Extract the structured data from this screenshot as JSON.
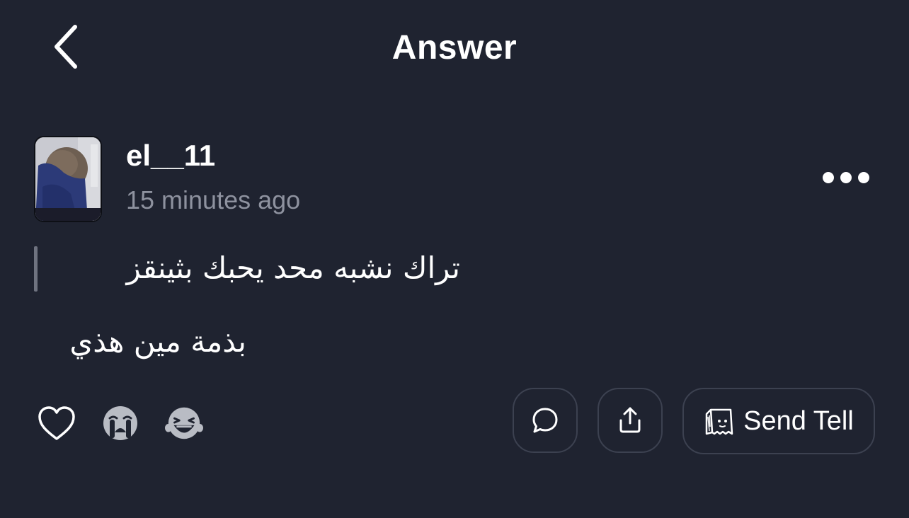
{
  "header": {
    "title": "Answer"
  },
  "post": {
    "username": "el__11",
    "time": "15 minutes ago",
    "question": "تراك نشبه محد يحبك بثينقز",
    "answer": "بذمة مين هذي"
  },
  "actions": {
    "send_tell_label": "Send Tell"
  },
  "icons": {
    "back": "chevron-left-icon",
    "more": "more-horizontal-icon",
    "like": "heart-icon",
    "cry": "crying-face-icon",
    "laugh": "laughing-face-icon",
    "comment": "speech-bubble-icon",
    "share": "share-icon",
    "tell": "bag-ghost-icon"
  },
  "colors": {
    "background": "#1f2330",
    "text": "#ffffff",
    "muted": "#8e929f",
    "border": "#3c4150",
    "quote_bar": "#6f7380"
  }
}
